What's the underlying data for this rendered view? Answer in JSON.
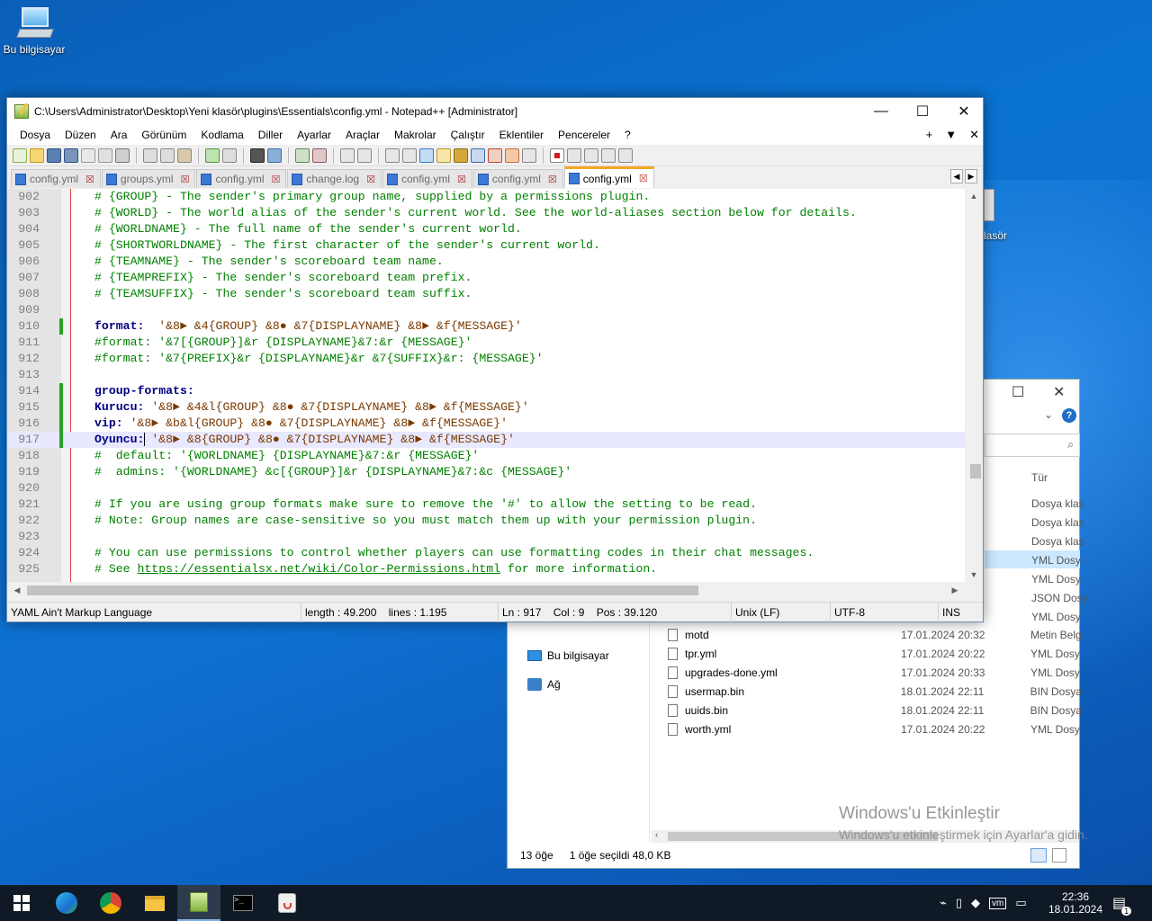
{
  "desktop": {
    "icon_label": "Bu bilgisayar",
    "partial_label": "lasör"
  },
  "notepad": {
    "title": "C:\\Users\\Administrator\\Desktop\\Yeni klasör\\plugins\\Essentials\\config.yml - Notepad++ [Administrator]",
    "menu": [
      "Dosya",
      "Düzen",
      "Ara",
      "Görünüm",
      "Kodlama",
      "Diller",
      "Ayarlar",
      "Araçlar",
      "Makrolar",
      "Çalıştır",
      "Eklentiler",
      "Pencereler",
      "?"
    ],
    "menu_right": [
      "+",
      "▼",
      "✕"
    ],
    "tabs": [
      {
        "label": "config.yml",
        "active": false
      },
      {
        "label": "groups.yml",
        "active": false
      },
      {
        "label": "config.yml",
        "active": false
      },
      {
        "label": "change.log",
        "active": false
      },
      {
        "label": "config.yml",
        "active": false
      },
      {
        "label": "config.yml",
        "active": false
      },
      {
        "label": "config.yml",
        "active": true
      }
    ],
    "lines": [
      {
        "n": "902",
        "text": "# {GROUP} - The sender's primary group name, supplied by a permissions plugin.",
        "t": "cmt"
      },
      {
        "n": "903",
        "text": "# {WORLD} - The world alias of the sender's current world. See the world-aliases section below for details.",
        "t": "cmt"
      },
      {
        "n": "904",
        "text": "# {WORLDNAME} - The full name of the sender's current world.",
        "t": "cmt"
      },
      {
        "n": "905",
        "text": "# {SHORTWORLDNAME} - The first character of the sender's current world.",
        "t": "cmt"
      },
      {
        "n": "906",
        "text": "# {TEAMNAME} - The sender's scoreboard team name.",
        "t": "cmt"
      },
      {
        "n": "907",
        "text": "# {TEAMPREFIX} - The sender's scoreboard team prefix.",
        "t": "cmt"
      },
      {
        "n": "908",
        "text": "# {TEAMSUFFIX} - The sender's scoreboard team suffix.",
        "t": "cmt"
      },
      {
        "n": "909",
        "text": "",
        "t": "cmt"
      },
      {
        "n": "910",
        "key": "format:",
        "val": "  '&8► &4{GROUP} &8● &7{DISPLAYNAME} &8► &f{MESSAGE}'",
        "t": "kv",
        "chg": true
      },
      {
        "n": "911",
        "text": "#format: '&7[{GROUP}]&r {DISPLAYNAME}&7:&r {MESSAGE}'",
        "t": "cmt"
      },
      {
        "n": "912",
        "text": "#format: '&7{PREFIX}&r {DISPLAYNAME}&r &7{SUFFIX}&r: {MESSAGE}'",
        "t": "cmt"
      },
      {
        "n": "913",
        "text": "",
        "t": "cmt"
      },
      {
        "n": "914",
        "key": "group-formats:",
        "val": "",
        "t": "kv",
        "chg": true
      },
      {
        "n": "915",
        "key": "Kurucu:",
        "val": " '&8► &4&l{GROUP} &8● &7{DISPLAYNAME} &8► &f{MESSAGE}'",
        "t": "kv",
        "chg": true
      },
      {
        "n": "916",
        "key": "vip:",
        "val": " '&8► &b&l{GROUP} &8● &7{DISPLAYNAME} &8► &f{MESSAGE}'",
        "t": "kv",
        "chg": true
      },
      {
        "n": "917",
        "key": "Oyuncu:",
        "val": " '&8► &8{GROUP} &8● &7{DISPLAYNAME} &8► &f{MESSAGE}'",
        "t": "kv",
        "chg": true,
        "current": true
      },
      {
        "n": "918",
        "text": "#  default: '{WORLDNAME} {DISPLAYNAME}&7:&r {MESSAGE}'",
        "t": "cmt"
      },
      {
        "n": "919",
        "text": "#  admins: '{WORLDNAME} &c[{GROUP}]&r {DISPLAYNAME}&7:&c {MESSAGE}'",
        "t": "cmt"
      },
      {
        "n": "920",
        "text": "",
        "t": "cmt"
      },
      {
        "n": "921",
        "text": "# If you are using group formats make sure to remove the '#' to allow the setting to be read.",
        "t": "cmt"
      },
      {
        "n": "922",
        "text": "# Note: Group names are case-sensitive so you must match them up with your permission plugin.",
        "t": "cmt"
      },
      {
        "n": "923",
        "text": "",
        "t": "cmt"
      },
      {
        "n": "924",
        "text": "# You can use permissions to control whether players can use formatting codes in their chat messages.",
        "t": "cmt"
      },
      {
        "n": "925",
        "text": "# See ",
        "url": "https://essentialsx.net/wiki/Color-Permissions.html",
        "after": " for more information.",
        "t": "cmt"
      }
    ],
    "status": {
      "language": "YAML Ain't Markup Language",
      "length": "length : 49.200",
      "lines": "lines : 1.195",
      "ln": "Ln : 917",
      "col": "Col : 9",
      "pos": "Pos : 39.120",
      "eol": "Unix (LF)",
      "encoding": "UTF-8",
      "mode": "INS"
    }
  },
  "explorer": {
    "header_col": "Tür",
    "nav": [
      "Bu bilgisayar",
      "Ağ"
    ],
    "types_above": [
      "Dosya klas",
      "Dosya klas",
      "Dosya klas",
      "YML Dosy",
      "YML Dosy",
      "JSON Dosy",
      "YML Dosy"
    ],
    "files": [
      {
        "name": "motd",
        "date": "17.01.2024 20:32",
        "type": "Metin Belg"
      },
      {
        "name": "tpr.yml",
        "date": "17.01.2024 20:22",
        "type": "YML Dosy"
      },
      {
        "name": "upgrades-done.yml",
        "date": "17.01.2024 20:33",
        "type": "YML Dosy"
      },
      {
        "name": "usermap.bin",
        "date": "18.01.2024 22:11",
        "type": "BIN Dosya"
      },
      {
        "name": "uuids.bin",
        "date": "18.01.2024 22:11",
        "type": "BIN Dosya"
      },
      {
        "name": "worth.yml",
        "date": "17.01.2024 20:22",
        "type": "YML Dosy"
      }
    ],
    "status_count": "13 öğe",
    "status_selected": "1 öğe seçildi  48,0 KB"
  },
  "watermark": {
    "title": "Windows'u Etkinleştir",
    "subtitle": "Windows'u etkinleştirmek için Ayarlar'a gidin."
  },
  "taskbar": {
    "time": "22:36",
    "date": "18.01.2024",
    "notif_count": "1"
  }
}
